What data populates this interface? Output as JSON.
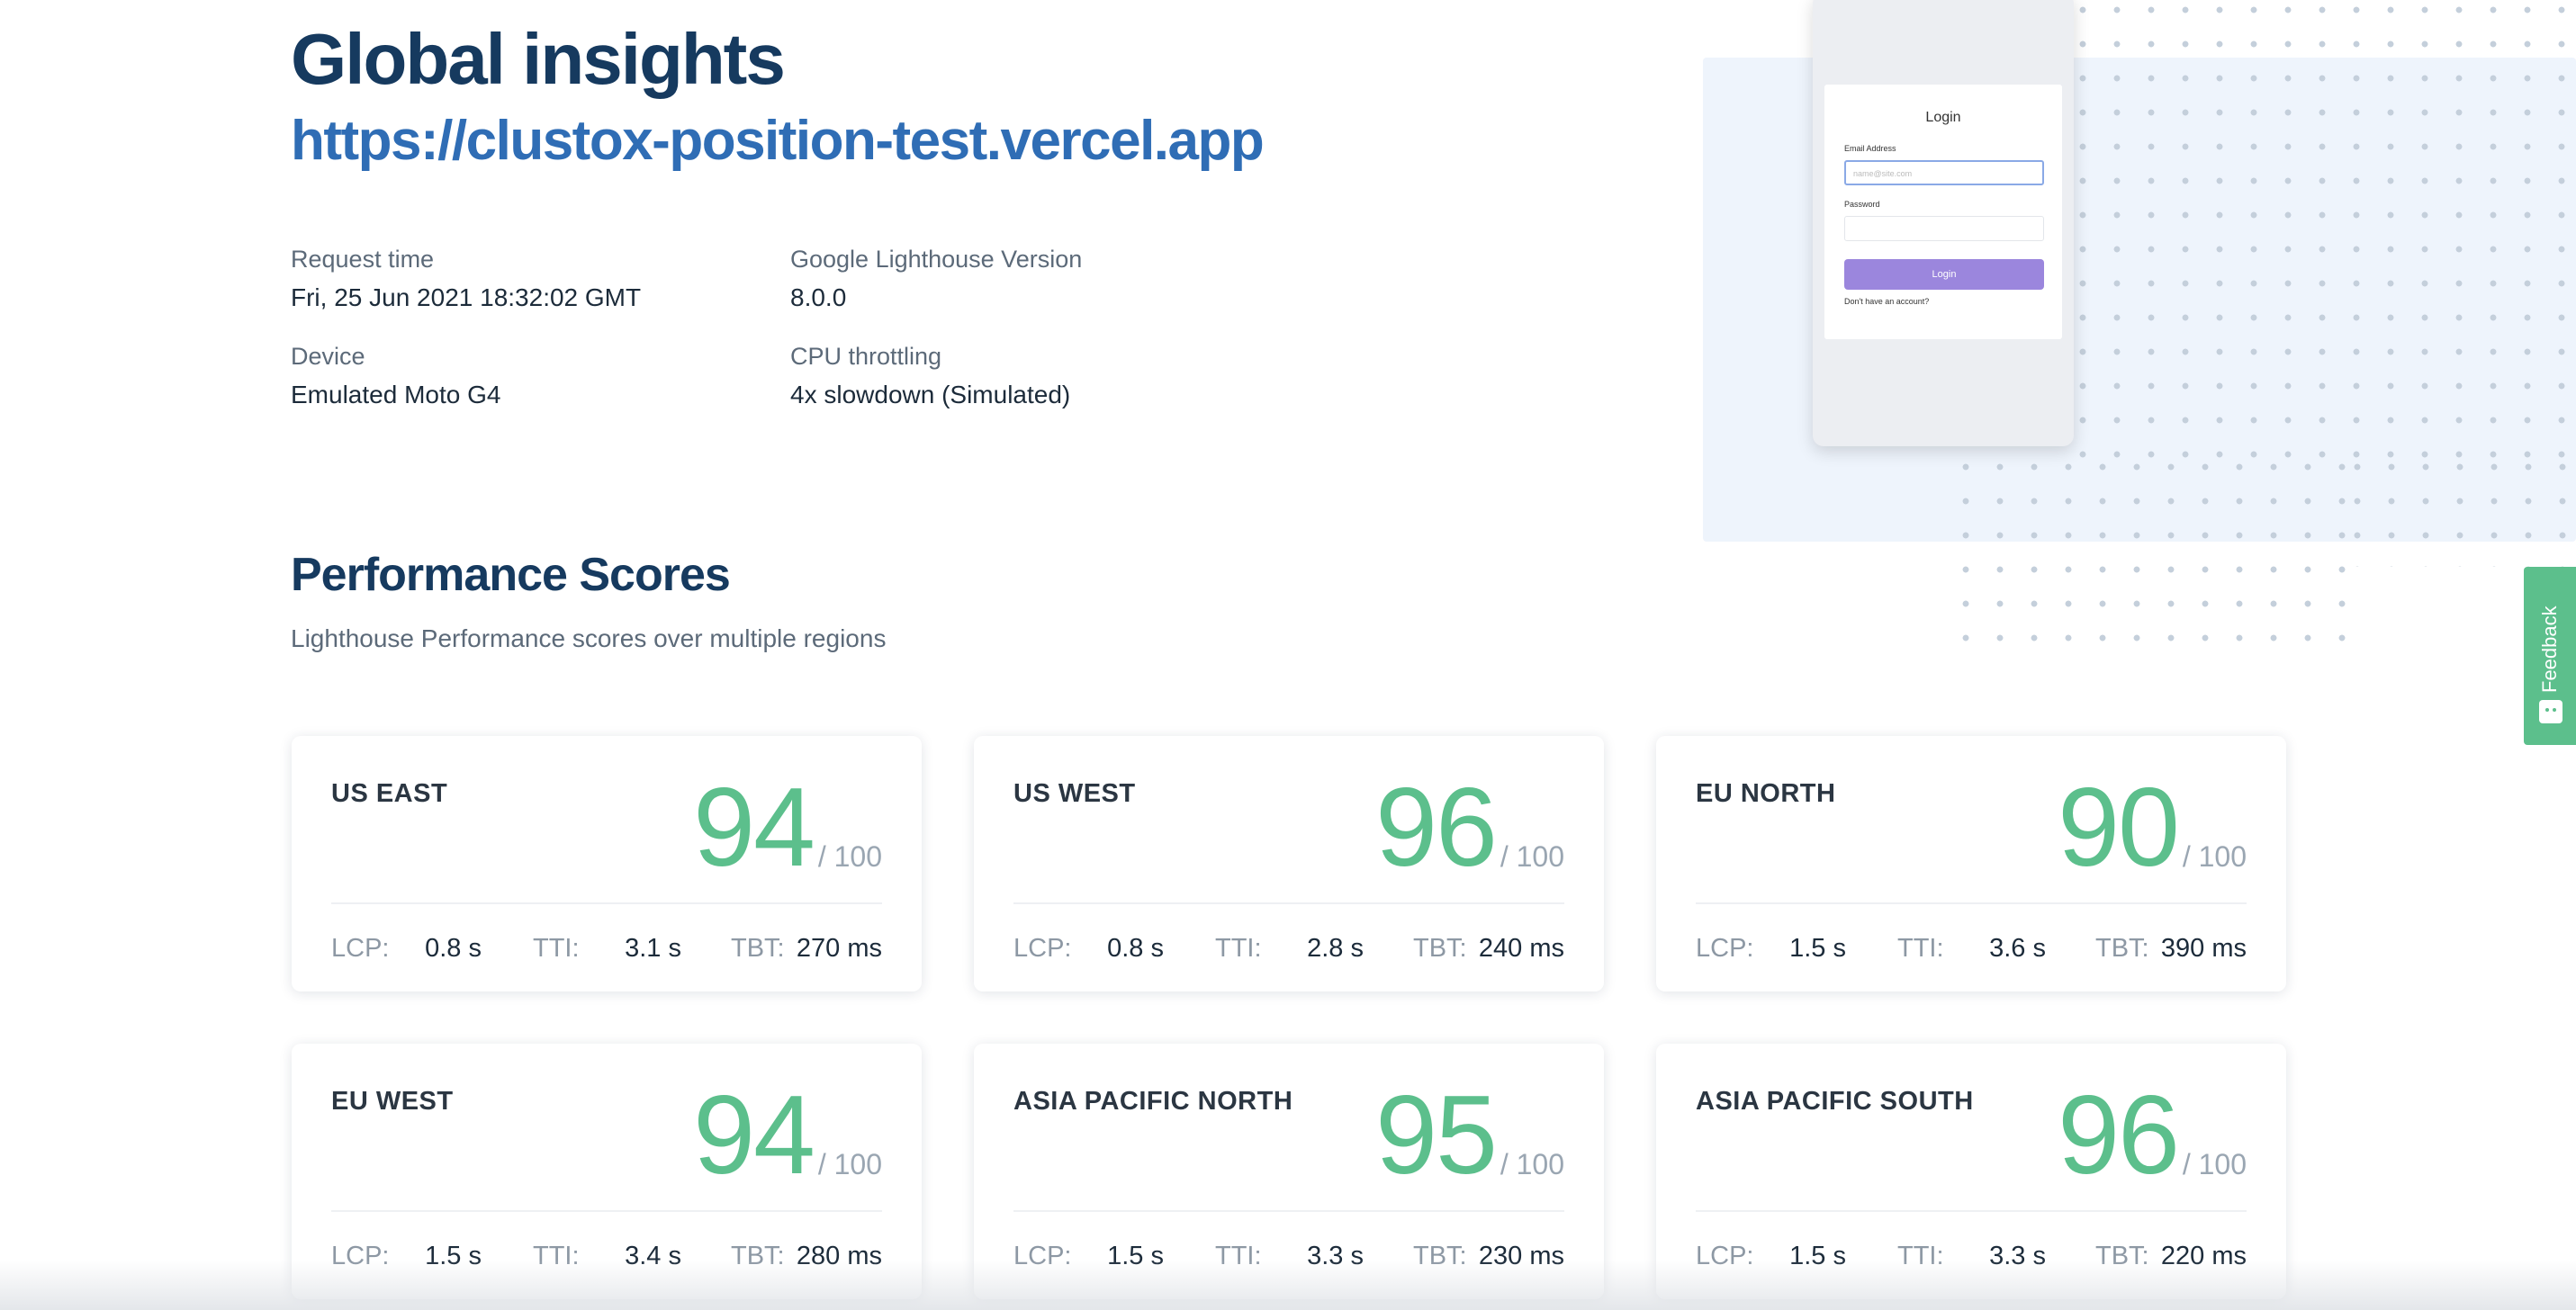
{
  "header": {
    "title": "Global insights",
    "url": "https://clustox-position-test.vercel.app"
  },
  "meta": {
    "request_time_label": "Request time",
    "request_time_value": "Fri, 25 Jun 2021 18:32:02 GMT",
    "lighthouse_label": "Google Lighthouse Version",
    "lighthouse_value": "8.0.0",
    "device_label": "Device",
    "device_value": "Emulated Moto G4",
    "cpu_label": "CPU throttling",
    "cpu_value": "4x slowdown (Simulated)"
  },
  "preview": {
    "title": "Login",
    "email_label": "Email Address",
    "email_placeholder": "name@site.com",
    "password_label": "Password",
    "button": "Login",
    "account_text": "Don't have an account?"
  },
  "feedback": {
    "label": "Feedback",
    "icon": "smile-icon"
  },
  "section": {
    "title": "Performance Scores",
    "subtitle": "Lighthouse Performance scores over multiple regions"
  },
  "metric_labels": {
    "lcp": "LCP:",
    "tti": "TTI:",
    "tbt": "TBT:",
    "max": "/ 100"
  },
  "cards": [
    {
      "region": "US EAST",
      "score": "94",
      "lcp": "0.8 s",
      "tti": "3.1 s",
      "tbt": "270 ms"
    },
    {
      "region": "US WEST",
      "score": "96",
      "lcp": "0.8 s",
      "tti": "2.8 s",
      "tbt": "240 ms"
    },
    {
      "region": "EU NORTH",
      "score": "90",
      "lcp": "1.5 s",
      "tti": "3.6 s",
      "tbt": "390 ms"
    },
    {
      "region": "EU WEST",
      "score": "94",
      "lcp": "1.5 s",
      "tti": "3.4 s",
      "tbt": "280 ms"
    },
    {
      "region": "ASIA PACIFIC NORTH",
      "score": "95",
      "lcp": "1.5 s",
      "tti": "3.3 s",
      "tbt": "230 ms"
    },
    {
      "region": "ASIA PACIFIC SOUTH",
      "score": "96",
      "lcp": "1.5 s",
      "tti": "3.3 s",
      "tbt": "220 ms"
    }
  ],
  "colors": {
    "title": "#163a5f",
    "url": "#2f6db5",
    "score": "#5cbf8c",
    "feedback": "#5cbf8c",
    "login_button": "#9b86dd"
  }
}
